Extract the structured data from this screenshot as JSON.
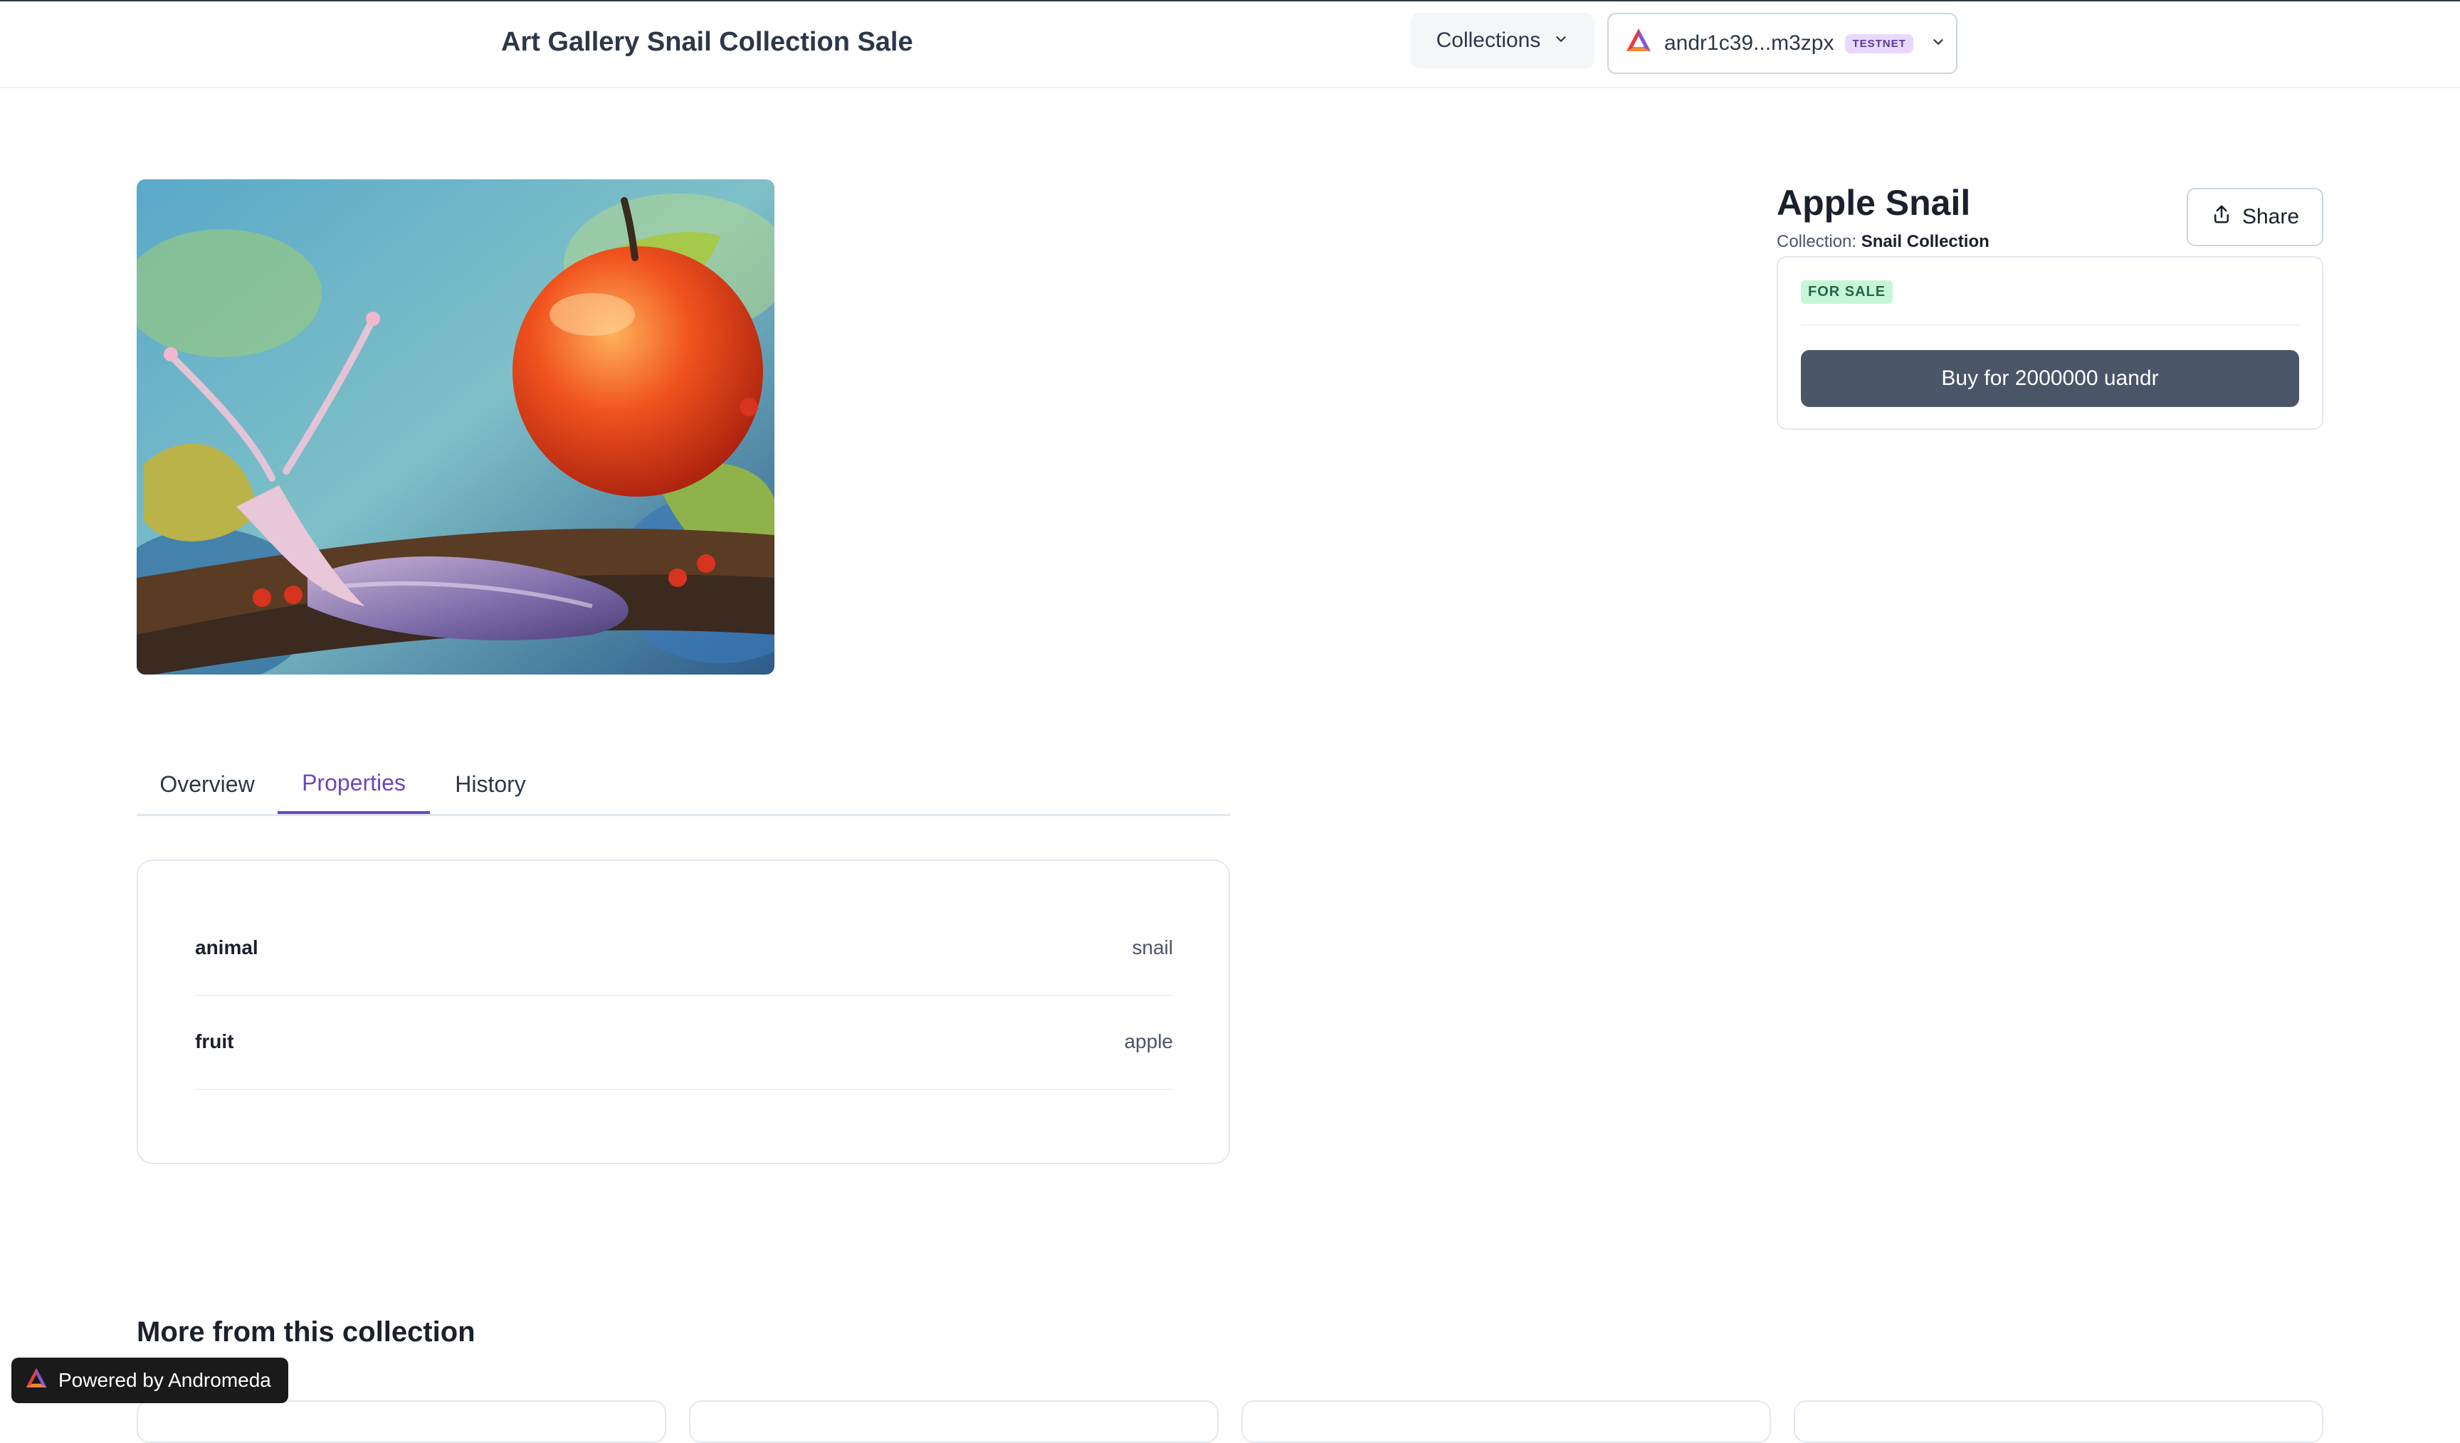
{
  "header": {
    "site_title": "Art Gallery Snail Collection Sale",
    "collections_label": "Collections",
    "wallet_address": "andr1c39...m3zpx",
    "network_badge": "TESTNET"
  },
  "nft": {
    "title": "Apple Snail",
    "collection_prefix": "Collection:",
    "collection_name": "Snail Collection",
    "share_label": "Share",
    "status_badge": "FOR SALE",
    "buy_label": "Buy for 2000000 uandr"
  },
  "tabs": [
    {
      "label": "Overview"
    },
    {
      "label": "Properties"
    },
    {
      "label": "History"
    }
  ],
  "active_tab": "Properties",
  "properties": [
    {
      "key": "animal",
      "value": "snail"
    },
    {
      "key": "fruit",
      "value": "apple"
    }
  ],
  "more_section": {
    "heading": "More from this collection"
  },
  "footer": {
    "powered_by": "Powered by Andromeda"
  },
  "colors": {
    "accent_purple": "#6b46c1",
    "buy_button": "#4a5568",
    "for_sale_green": "#276749"
  },
  "icons": [
    "andromeda-logo-icon",
    "chevron-down-icon",
    "share-icon"
  ]
}
